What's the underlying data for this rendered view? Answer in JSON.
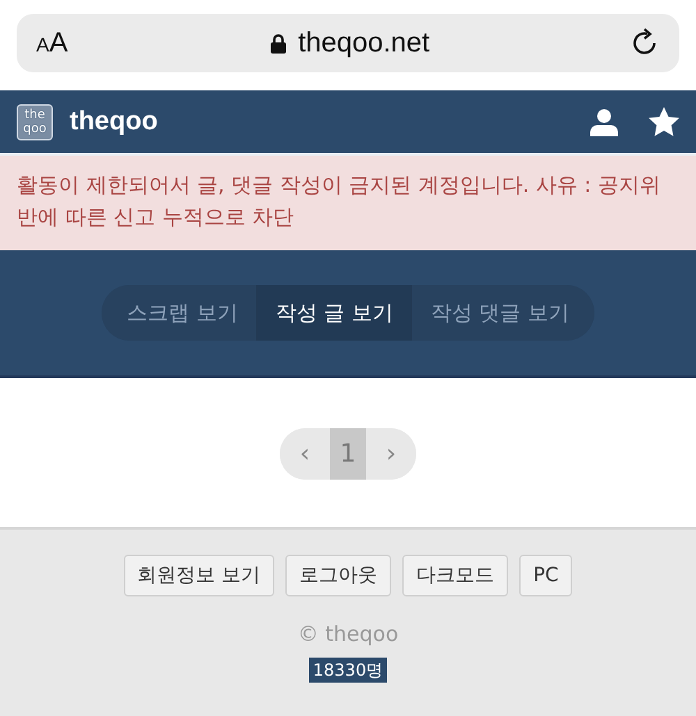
{
  "browser": {
    "text_size_button": "AA",
    "url": "theqoo.net"
  },
  "header": {
    "logo_lines": [
      "the",
      "qoo"
    ],
    "site_name": "theqoo"
  },
  "alert": {
    "message": "활동이 제한되어서 글, 댓글 작성이 금지된 계정입니다. 사유 : 공지위반에 따른 신고 누적으로 차단"
  },
  "tabs": [
    {
      "label": "스크랩 보기",
      "selected": false
    },
    {
      "label": "작성 글 보기",
      "selected": true
    },
    {
      "label": "작성 댓글 보기",
      "selected": false
    }
  ],
  "pagination": {
    "prev": "‹",
    "pages": [
      {
        "label": "1",
        "selected": true
      }
    ],
    "next": "›"
  },
  "footer": {
    "buttons": [
      "회원정보 보기",
      "로그아웃",
      "다크모드",
      "PC"
    ],
    "copyright": "© theqoo",
    "visitor_count": "18330명"
  }
}
